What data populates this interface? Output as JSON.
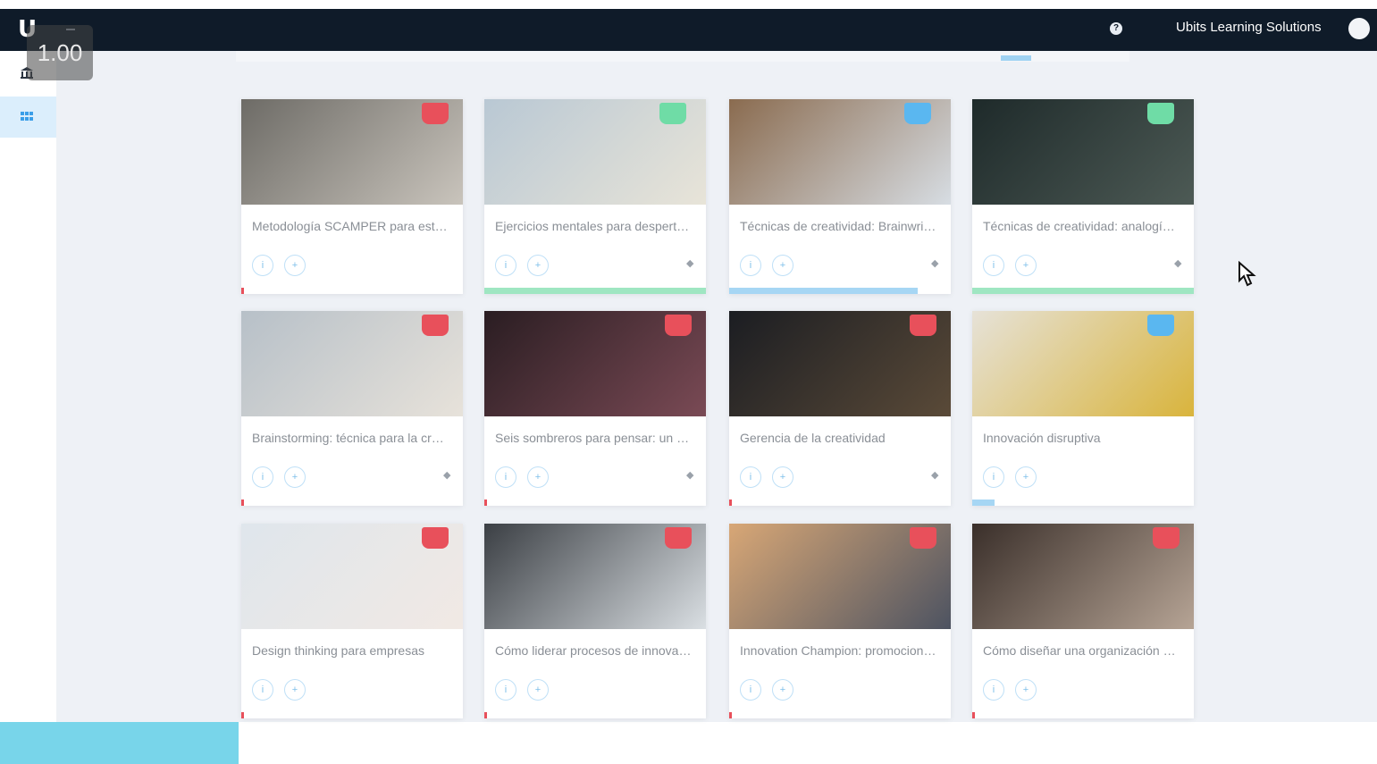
{
  "topbar": {
    "logo": "U",
    "help_icon": "question-circle-icon",
    "company_name": "Ubits Learning Solutions"
  },
  "overlay": {
    "speed": "1.00"
  },
  "sidebar": {
    "items": [
      {
        "icon": "bank-icon",
        "active": false
      },
      {
        "icon": "grid-icon",
        "active": true
      }
    ]
  },
  "colors": {
    "topbar": "#0f1b29",
    "content_bg": "#eef1f6",
    "badge_red": "#e8505b",
    "badge_green": "#6fdca6",
    "badge_blue": "#5ab7f0",
    "progress_green": "#9fe6c2",
    "progress_blue": "#a6d6f4",
    "accent_cyan": "#78d5ea"
  },
  "cards": [
    {
      "title": "Metodología SCAMPER para estructurar...",
      "badge_color": "red",
      "progress": 0.0,
      "pinned": false
    },
    {
      "title": "Ejercicios mentales para despertar la...",
      "badge_color": "green",
      "progress": 1.0,
      "pinned": true
    },
    {
      "title": "Técnicas de creatividad: Brainwriting",
      "badge_color": "blue",
      "progress": 0.85,
      "pinned": true
    },
    {
      "title": "Técnicas de creatividad: analogías fo...",
      "badge_color": "green",
      "progress": 1.0,
      "pinned": true
    },
    {
      "title": "Brainstorming: técnica para la creaci...",
      "badge_color": "red",
      "progress": 0.0,
      "pinned": true
    },
    {
      "title": "Seis sombreros para pensar: un pun...",
      "badge_color": "red",
      "progress": 0.0,
      "pinned": true
    },
    {
      "title": "Gerencia de la creatividad",
      "badge_color": "red",
      "progress": 0.0,
      "pinned": true
    },
    {
      "title": "Innovación disruptiva",
      "badge_color": "blue",
      "progress": 0.1,
      "pinned": false
    },
    {
      "title": "Design thinking para empresas",
      "badge_color": "red",
      "progress": 0.0,
      "pinned": false
    },
    {
      "title": "Cómo liderar procesos de innovació...",
      "badge_color": "red",
      "progress": 0.0,
      "pinned": false
    },
    {
      "title": "Innovation Champion: promocione un...",
      "badge_color": "red",
      "progress": 0.0,
      "pinned": false
    },
    {
      "title": "Cómo diseñar una organización para...",
      "badge_color": "red",
      "progress": 0.0,
      "pinned": false
    }
  ]
}
